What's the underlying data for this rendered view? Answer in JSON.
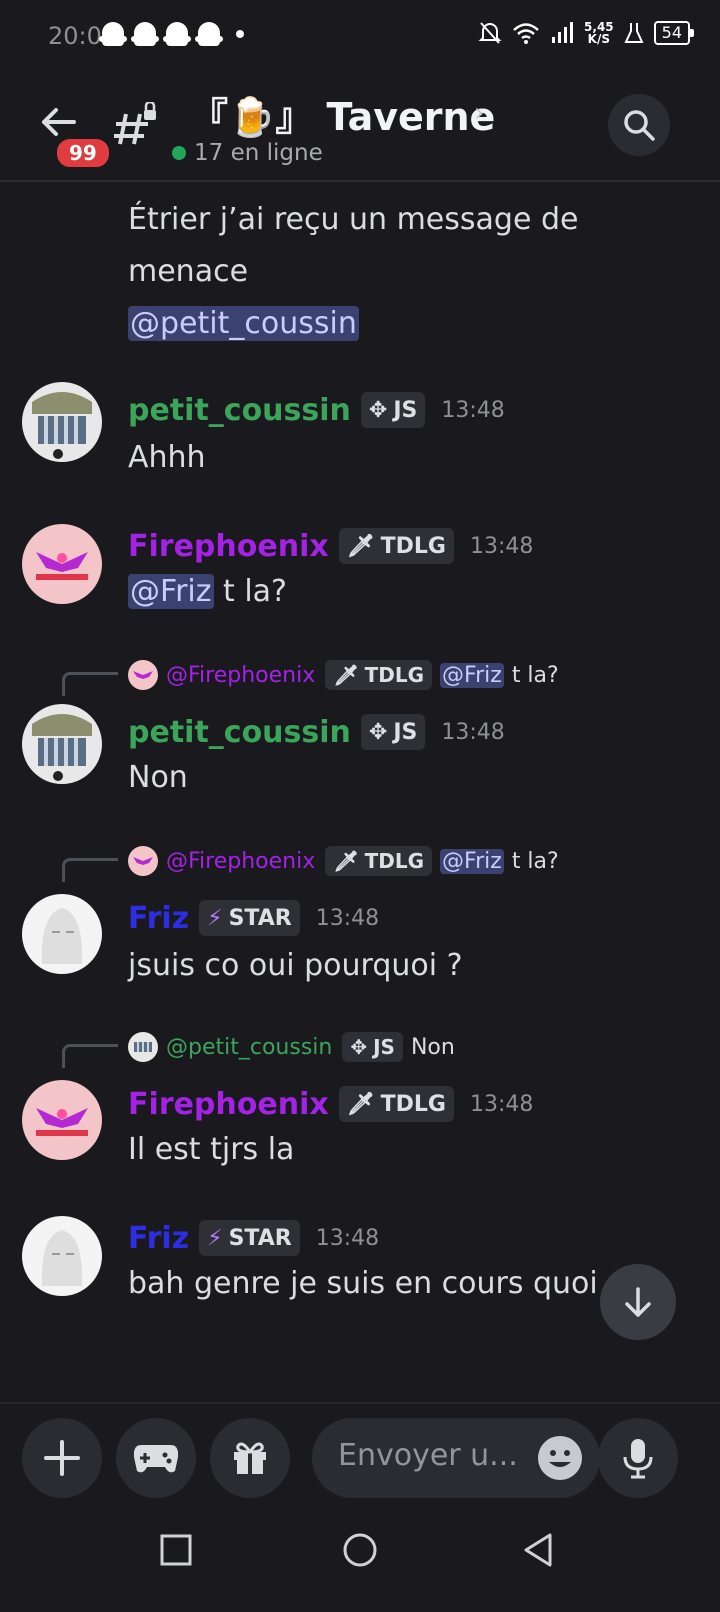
{
  "status": {
    "time": "20:01",
    "speed_top": "5,45",
    "speed_bottom": "K/S",
    "battery": "54"
  },
  "header": {
    "badge": "99",
    "title": "『🍺』 Taverne",
    "online": "17 en ligne"
  },
  "messages": {
    "intro_line1": "Étrier j’ai reçu un message de",
    "intro_line2": "menace",
    "intro_mention": "@petit_coussin",
    "m1": {
      "author": "petit_coussin",
      "tag": "JS",
      "time": "13:48",
      "text": "Ahhh"
    },
    "m2": {
      "author": "Firephoenix",
      "tag": "TDLG",
      "time": "13:48",
      "mention": "@Friz",
      "text": " t la?"
    },
    "m3": {
      "reply_author": "@Firephoenix",
      "reply_tag": "TDLG",
      "reply_mention": "@Friz",
      "reply_text": "t la?",
      "author": "petit_coussin",
      "tag": "JS",
      "time": "13:48",
      "text": "Non"
    },
    "m4": {
      "reply_author": "@Firephoenix",
      "reply_tag": "TDLG",
      "reply_mention": "@Friz",
      "reply_text": "t la?",
      "author": "Friz",
      "tag": "STAR",
      "time": "13:48",
      "text": "jsuis co oui pourquoi ?"
    },
    "m5": {
      "reply_author": "@petit_coussin",
      "reply_tag": "JS",
      "reply_text": "Non",
      "author": "Firephoenix",
      "tag": "TDLG",
      "time": "13:48",
      "text": "Il est tjrs la"
    },
    "m6": {
      "author": "Friz",
      "tag": "STAR",
      "time": "13:48",
      "text": "bah genre je suis en cours quoi"
    }
  },
  "composer": {
    "placeholder": "Envoyer u..."
  },
  "colors": {
    "petit_coussin": "#3ba55c",
    "Firephoenix": "#a322e6",
    "Friz": "#2d2de6",
    "mention_bg": "#3c4270"
  }
}
